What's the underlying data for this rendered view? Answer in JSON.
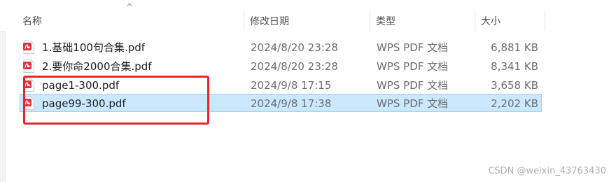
{
  "columns": {
    "name": "名称",
    "date": "修改日期",
    "type": "类型",
    "size": "大小"
  },
  "sort_indicator": "^",
  "files": [
    {
      "name": "1.基础100句合集.pdf",
      "date": "2024/8/20 23:28",
      "type": "WPS PDF 文档",
      "size": "6,881 KB",
      "icon": "pdf-file-icon",
      "selected": false
    },
    {
      "name": "2.要你命2000合集.pdf",
      "date": "2024/8/20 23:28",
      "type": "WPS PDF 文档",
      "size": "8,341 KB",
      "icon": "pdf-file-icon",
      "selected": false
    },
    {
      "name": "page1-300.pdf",
      "date": "2024/9/8 17:15",
      "type": "WPS PDF 文档",
      "size": "3,658 KB",
      "icon": "pdf-file-icon",
      "selected": false
    },
    {
      "name": "page99-300.pdf",
      "date": "2024/9/8 17:38",
      "type": "WPS PDF 文档",
      "size": "2,202 KB",
      "icon": "pdf-file-icon",
      "selected": true
    }
  ],
  "annotation": {
    "color": "#e8262b"
  },
  "watermark": "CSDN @weixin_43763430",
  "colors": {
    "selection_bg": "#cce8ff",
    "selection_border": "#99d1ff",
    "pdf_icon_red": "#d9363e"
  }
}
